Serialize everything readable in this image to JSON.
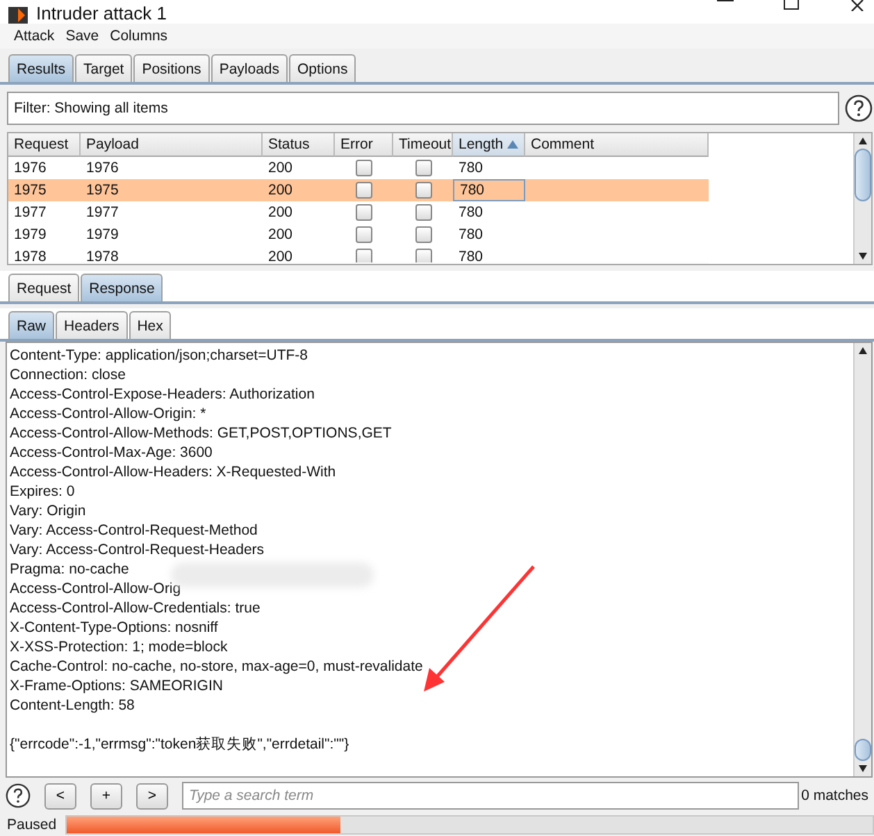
{
  "window": {
    "title": "Intruder attack 1"
  },
  "menu": [
    "Attack",
    "Save",
    "Columns"
  ],
  "tabs": [
    {
      "label": "Results",
      "selected": true
    },
    {
      "label": "Target",
      "selected": false
    },
    {
      "label": "Positions",
      "selected": false
    },
    {
      "label": "Payloads",
      "selected": false
    },
    {
      "label": "Options",
      "selected": false
    }
  ],
  "filter": {
    "text": "Filter: Showing all items"
  },
  "table": {
    "columns": [
      {
        "label": "Request",
        "sorted": false
      },
      {
        "label": "Payload",
        "sorted": false
      },
      {
        "label": "Status",
        "sorted": false
      },
      {
        "label": "Error",
        "sorted": false
      },
      {
        "label": "Timeout",
        "sorted": false
      },
      {
        "label": "Length",
        "sorted": true
      },
      {
        "label": "Comment",
        "sorted": false
      }
    ],
    "rows": [
      {
        "request": "1976",
        "payload": "1976",
        "status": "200",
        "error": false,
        "timeout": false,
        "length": "780",
        "selected": false
      },
      {
        "request": "1975",
        "payload": "1975",
        "status": "200",
        "error": false,
        "timeout": false,
        "length": "780",
        "selected": true
      },
      {
        "request": "1977",
        "payload": "1977",
        "status": "200",
        "error": false,
        "timeout": false,
        "length": "780",
        "selected": false
      },
      {
        "request": "1979",
        "payload": "1979",
        "status": "200",
        "error": false,
        "timeout": false,
        "length": "780",
        "selected": false
      },
      {
        "request": "1978",
        "payload": "1978",
        "status": "200",
        "error": false,
        "timeout": false,
        "length": "780",
        "selected": false
      }
    ]
  },
  "message_tabs": [
    {
      "label": "Request",
      "selected": false
    },
    {
      "label": "Response",
      "selected": true
    }
  ],
  "view_tabs": [
    {
      "label": "Raw",
      "selected": true
    },
    {
      "label": "Headers",
      "selected": false
    },
    {
      "label": "Hex",
      "selected": false
    }
  ],
  "response_lines": [
    "Content-Type: application/json;charset=UTF-8",
    "Connection: close",
    "Access-Control-Expose-Headers: Authorization",
    "Access-Control-Allow-Origin: *",
    "Access-Control-Allow-Methods: GET,POST,OPTIONS,GET",
    "Access-Control-Max-Age: 3600",
    "Access-Control-Allow-Headers: X-Requested-With",
    "Expires: 0",
    "Vary: Origin",
    "Vary: Access-Control-Request-Method",
    "Vary: Access-Control-Request-Headers",
    "Pragma: no-cache",
    "Access-Control-Allow-Orig",
    "Access-Control-Allow-Credentials: true",
    "X-Content-Type-Options: nosniff",
    "X-XSS-Protection: 1; mode=block",
    "Cache-Control: no-cache, no-store, max-age=0, must-revalidate",
    "X-Frame-Options: SAMEORIGIN",
    "Content-Length: 58"
  ],
  "response_body": "{\"errcode\":-1,\"errmsg\":\"token获取失败\",\"errdetail\":\"\"}",
  "search": {
    "buttons": [
      "<",
      "+",
      ">"
    ],
    "placeholder": "Type a search term",
    "matches": "0 matches"
  },
  "status_bar": {
    "text": "Paused",
    "level": 0.34
  }
}
